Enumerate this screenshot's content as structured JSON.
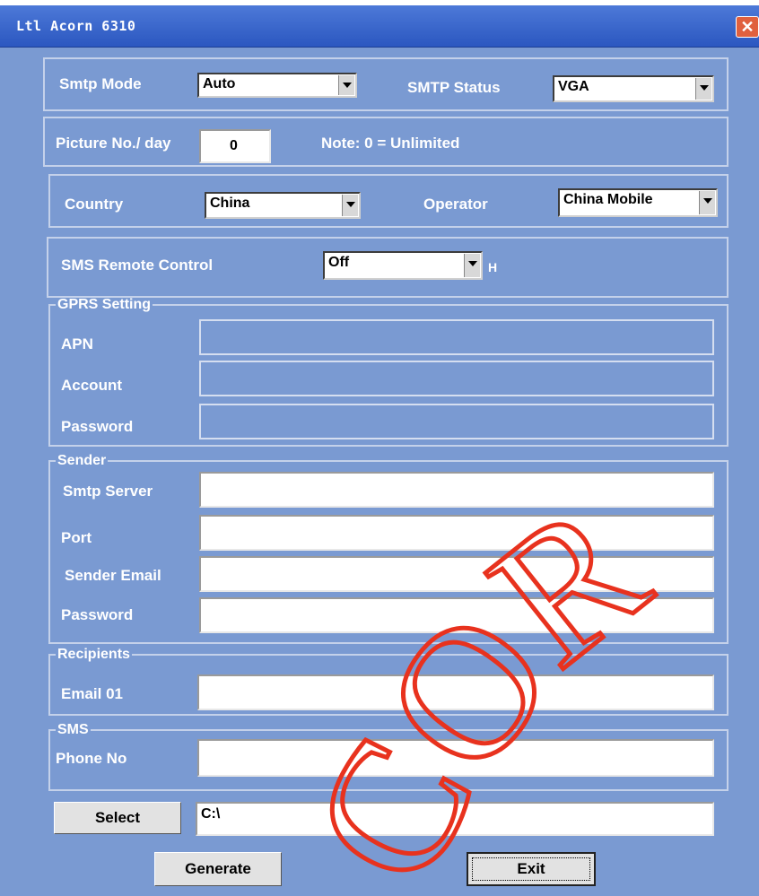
{
  "window": {
    "title": "Ltl Acorn 6310",
    "close_glyph": "✕"
  },
  "smtp": {
    "mode_label": "Smtp Mode",
    "mode_value": "Auto",
    "status_label": "SMTP Status",
    "status_value": "VGA"
  },
  "picture": {
    "label": "Picture No./ day",
    "value": "0",
    "note": "Note: 0 = Unlimited"
  },
  "region": {
    "country_label": "Country",
    "country_value": "China",
    "operator_label": "Operator",
    "operator_value": "China Mobile"
  },
  "sms_remote": {
    "label": "SMS Remote Control",
    "value": "Off",
    "suffix": "H"
  },
  "gprs": {
    "legend": "GPRS Setting",
    "apn_label": "APN",
    "account_label": "Account",
    "password_label": "Password"
  },
  "sender": {
    "legend": "Sender",
    "server_label": "Smtp Server",
    "port_label": "Port",
    "email_label": "Sender Email",
    "password_label": "Password"
  },
  "recipients": {
    "legend": "Recipients",
    "email_label": "Email 01"
  },
  "sms": {
    "legend": "SMS",
    "phone_label": "Phone No"
  },
  "footer": {
    "select_label": "Select",
    "path_value": "C:\\",
    "generate_label": "Generate",
    "exit_label": "Exit"
  },
  "watermark": {
    "text": "COR",
    "color": "#e8321e"
  }
}
